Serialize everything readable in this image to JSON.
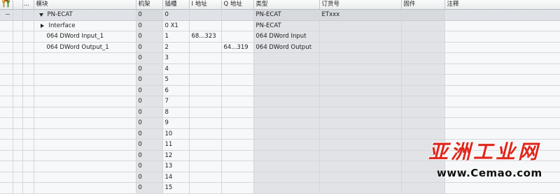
{
  "columns": [
    "",
    "",
    "...",
    "模块",
    "机架",
    "插槽",
    "I 地址",
    "Q 地址",
    "类型",
    "订货号",
    "固件",
    "注释"
  ],
  "rows": [
    {
      "level": 0,
      "expander": "expanded",
      "module": "PN-ECAT",
      "rack": "0",
      "slot": "0",
      "i_addr": "",
      "q_addr": "",
      "type": "PN-ECAT",
      "order": "ETxxx",
      "firmware": "",
      "comment": "",
      "selected": true
    },
    {
      "level": 1,
      "expander": "collapsed",
      "module": "Interface",
      "rack": "0",
      "slot": "0 X1",
      "i_addr": "",
      "q_addr": "",
      "type": "PN-ECAT",
      "order": "",
      "firmware": "",
      "comment": ""
    },
    {
      "level": 1,
      "expander": "none",
      "module": "064 DWord Input_1",
      "rack": "0",
      "slot": "1",
      "i_addr": "68...323",
      "q_addr": "",
      "type": "064 DWord Input",
      "order": "",
      "firmware": "",
      "comment": ""
    },
    {
      "level": 1,
      "expander": "none",
      "module": "064 DWord Output_1",
      "rack": "0",
      "slot": "2",
      "i_addr": "",
      "q_addr": "64...319",
      "type": "064 DWord Output",
      "order": "",
      "firmware": "",
      "comment": ""
    },
    {
      "level": 1,
      "expander": "none",
      "module": "",
      "rack": "0",
      "slot": "3",
      "i_addr": "",
      "q_addr": "",
      "type": "",
      "order": "",
      "firmware": "",
      "comment": ""
    },
    {
      "level": 1,
      "expander": "none",
      "module": "",
      "rack": "0",
      "slot": "4",
      "i_addr": "",
      "q_addr": "",
      "type": "",
      "order": "",
      "firmware": "",
      "comment": ""
    },
    {
      "level": 1,
      "expander": "none",
      "module": "",
      "rack": "0",
      "slot": "5",
      "i_addr": "",
      "q_addr": "",
      "type": "",
      "order": "",
      "firmware": "",
      "comment": ""
    },
    {
      "level": 1,
      "expander": "none",
      "module": "",
      "rack": "0",
      "slot": "6",
      "i_addr": "",
      "q_addr": "",
      "type": "",
      "order": "",
      "firmware": "",
      "comment": ""
    },
    {
      "level": 1,
      "expander": "none",
      "module": "",
      "rack": "0",
      "slot": "7",
      "i_addr": "",
      "q_addr": "",
      "type": "",
      "order": "",
      "firmware": "",
      "comment": ""
    },
    {
      "level": 1,
      "expander": "none",
      "module": "",
      "rack": "0",
      "slot": "8",
      "i_addr": "",
      "q_addr": "",
      "type": "",
      "order": "",
      "firmware": "",
      "comment": ""
    },
    {
      "level": 1,
      "expander": "none",
      "module": "",
      "rack": "0",
      "slot": "9",
      "i_addr": "",
      "q_addr": "",
      "type": "",
      "order": "",
      "firmware": "",
      "comment": ""
    },
    {
      "level": 1,
      "expander": "none",
      "module": "",
      "rack": "0",
      "slot": "10",
      "i_addr": "",
      "q_addr": "",
      "type": "",
      "order": "",
      "firmware": "",
      "comment": ""
    },
    {
      "level": 1,
      "expander": "none",
      "module": "",
      "rack": "0",
      "slot": "11",
      "i_addr": "",
      "q_addr": "",
      "type": "",
      "order": "",
      "firmware": "",
      "comment": ""
    },
    {
      "level": 1,
      "expander": "none",
      "module": "",
      "rack": "0",
      "slot": "12",
      "i_addr": "",
      "q_addr": "",
      "type": "",
      "order": "",
      "firmware": "",
      "comment": ""
    },
    {
      "level": 1,
      "expander": "none",
      "module": "",
      "rack": "0",
      "slot": "13",
      "i_addr": "",
      "q_addr": "",
      "type": "",
      "order": "",
      "firmware": "",
      "comment": ""
    },
    {
      "level": 1,
      "expander": "none",
      "module": "",
      "rack": "0",
      "slot": "14",
      "i_addr": "",
      "q_addr": "",
      "type": "",
      "order": "",
      "firmware": "",
      "comment": ""
    },
    {
      "level": 1,
      "expander": "none",
      "module": "",
      "rack": "0",
      "slot": "15",
      "i_addr": "",
      "q_addr": "",
      "type": "",
      "order": "",
      "firmware": "",
      "comment": ""
    }
  ],
  "watermark": {
    "title": "亚洲工业网",
    "url": "www.Cemao.com"
  }
}
